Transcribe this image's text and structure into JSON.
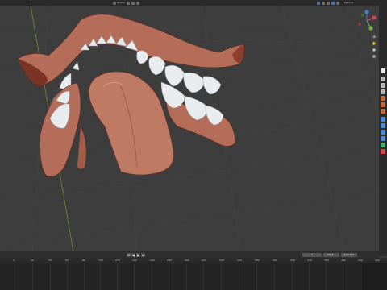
{
  "header": {
    "mode_label": "Global",
    "options_label": "Options",
    "view_label": "Viewing"
  },
  "nav_gizmo": {
    "axis_x": "X",
    "axis_y": "Y",
    "axis_z": "Z",
    "zoom_icon": "zoom-icon",
    "pan_icon": "hand-icon",
    "camera_icon": "camera-icon",
    "grid_icon": "grid-icon"
  },
  "playback": {
    "controls": [
      "⏮",
      "◀",
      "▶",
      "⏭"
    ],
    "frame_current": "0",
    "start_label": "Start",
    "start_value": "1",
    "end_label": "End",
    "end_value": "250"
  },
  "timeline": {
    "ticks": [
      "0",
      "20",
      "40",
      "60",
      "80",
      "100",
      "120",
      "140",
      "160",
      "180",
      "200",
      "220",
      "240",
      "260",
      "280",
      "300",
      "320",
      "340",
      "360",
      "380",
      "400",
      "420"
    ]
  },
  "colors": {
    "viewport_bg": "#3d3d3d",
    "gum": "#b46d59",
    "gum_dark": "#7a3324",
    "teeth": "#e9ecef",
    "tongue": "#bf7a63",
    "accent": "#4772b3"
  }
}
